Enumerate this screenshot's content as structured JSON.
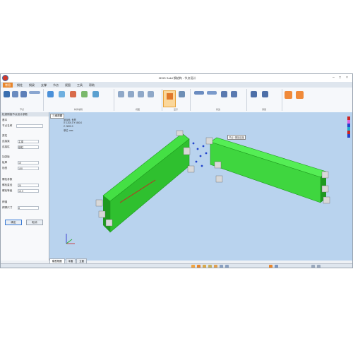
{
  "window": {
    "title": "3D3S Solid 钢结构 - 节点设计"
  },
  "tabs": [
    "常用",
    "钢柱",
    "钢梁",
    "支撑",
    "节点",
    "视图",
    "工具",
    "帮助"
  ],
  "ribbon": {
    "groups": [
      "节点",
      "构件编辑",
      "视图",
      "显示",
      "修改",
      "测量"
    ],
    "highlighted_label": "柱梁节点"
  },
  "panel": {
    "header": "柱梁刚接节点设计参数",
    "section1": "基本",
    "field_name_label": "节点名称",
    "field_name_value": "",
    "section2": "梁柱",
    "beam_label": "连接梁",
    "beam_value": "主梁",
    "column_label": "连接柱",
    "column_value": "钢柱",
    "section3": "加劲板",
    "plate_label": "板厚",
    "plate_value": "10",
    "rib_label": "肋宽",
    "rib_value": "100",
    "section4": "螺栓参数",
    "bolt_label": "螺栓直径",
    "bolt_value": "20",
    "grade_label": "螺栓等级",
    "grade_value": "10.9",
    "section5": "焊缝",
    "weld_label": "焊脚尺寸",
    "weld_value": "8",
    "ok_label": "确定",
    "cancel_label": "取消"
  },
  "viewport": {
    "tab_label": "三维视图",
    "coord_lines": [
      "坐标系: 世界",
      "X: 1200.0  Y: 850.0",
      "Z: 3000.0",
      "单位: mm"
    ],
    "node_label": "节点1 刚接连接"
  },
  "bottom_tabs": [
    "模型视图",
    "平面",
    "立面"
  ],
  "colors": {
    "accent": "#e8862c",
    "beam": "#33dd33",
    "beam_dark": "#1f9a1f",
    "viewport_bg": "#b9d3ee"
  }
}
